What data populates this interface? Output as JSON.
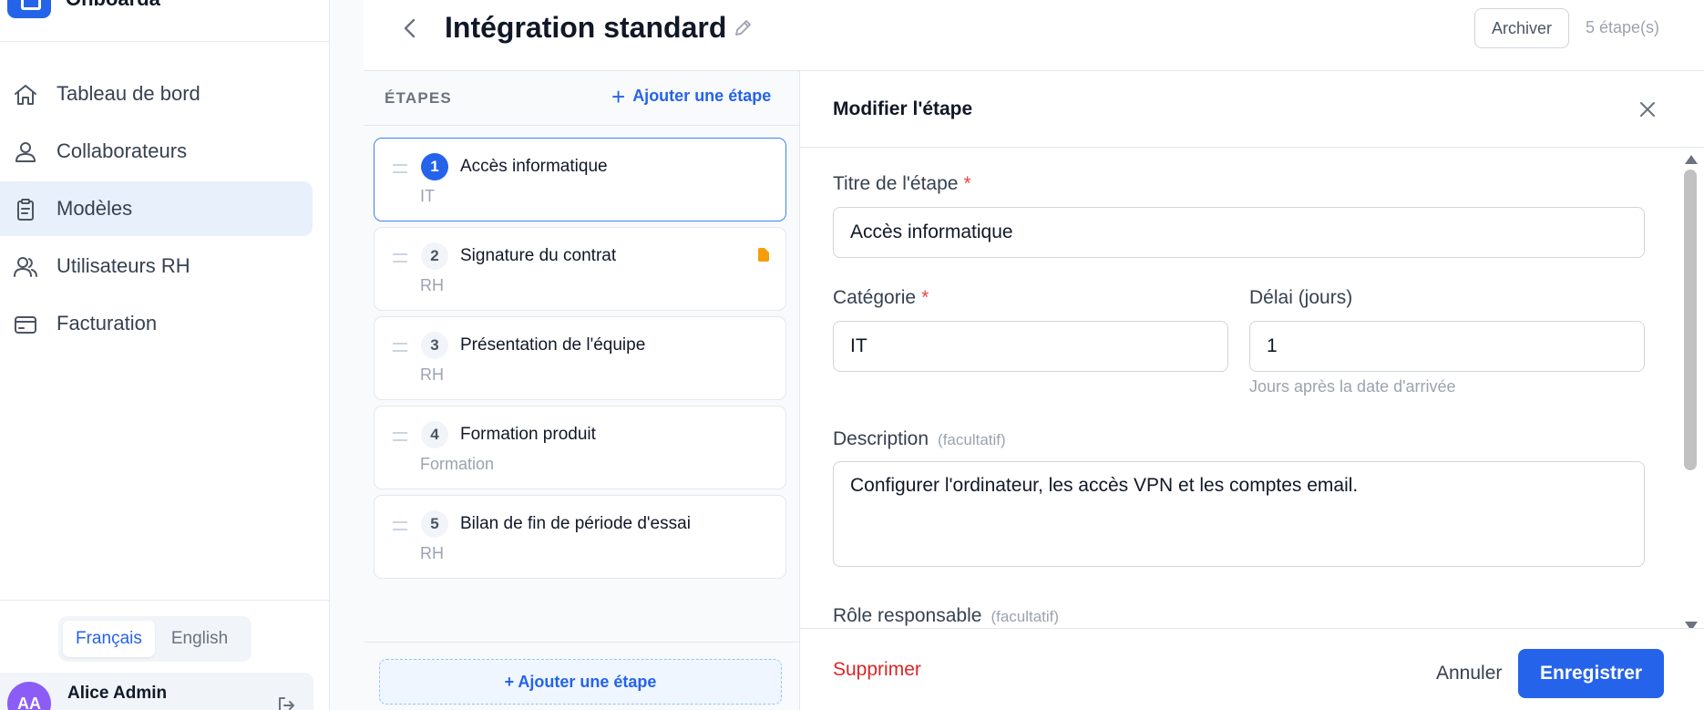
{
  "brand": {
    "name": "Onboarda"
  },
  "sidebar": {
    "items": [
      {
        "label": "Tableau de bord",
        "icon": "home-icon",
        "active": false
      },
      {
        "label": "Collaborateurs",
        "icon": "users-icon",
        "active": false
      },
      {
        "label": "Modèles",
        "icon": "clipboard-icon",
        "active": true
      },
      {
        "label": "Utilisateurs RH",
        "icon": "user-group-icon",
        "active": false
      },
      {
        "label": "Facturation",
        "icon": "credit-card-icon",
        "active": false
      }
    ],
    "languages": {
      "fr": "Français",
      "en": "English",
      "selected": "fr"
    },
    "user": {
      "initials": "AA",
      "name": "Alice Admin"
    }
  },
  "header": {
    "title": "Intégration standard",
    "archive_label": "Archiver",
    "steps_count": "5 étape(s)"
  },
  "steps_panel": {
    "title": "ÉTAPES",
    "add_link": "Ajouter une étape",
    "add_bottom": "+ Ajouter une étape",
    "steps": [
      {
        "number": "1",
        "title": "Accès informatique",
        "category": "IT",
        "has_document": false,
        "active": true
      },
      {
        "number": "2",
        "title": "Signature du contrat",
        "category": "RH",
        "has_document": true,
        "active": false
      },
      {
        "number": "3",
        "title": "Présentation de l'équipe",
        "category": "RH",
        "has_document": false,
        "active": false
      },
      {
        "number": "4",
        "title": "Formation produit",
        "category": "Formation",
        "has_document": false,
        "active": false
      },
      {
        "number": "5",
        "title": "Bilan de fin de période d'essai",
        "category": "RH",
        "has_document": false,
        "active": false
      }
    ]
  },
  "edit_panel": {
    "title": "Modifier l'étape",
    "fields": {
      "step_title": {
        "label": "Titre de l'étape",
        "required": "*",
        "value": "Accès informatique"
      },
      "category": {
        "label": "Catégorie",
        "required": "*",
        "value": "IT"
      },
      "delay": {
        "label": "Délai (jours)",
        "value": "1",
        "hint": "Jours après la date d'arrivée"
      },
      "description": {
        "label": "Description",
        "optional": "(facultatif)",
        "value": "Configurer l'ordinateur, les accès VPN et les comptes email."
      },
      "role": {
        "label": "Rôle responsable",
        "optional": "(facultatif)"
      }
    },
    "delete_label": "Supprimer",
    "cancel_label": "Annuler",
    "save_label": "Enregistrer"
  },
  "colors": {
    "accent": "#2563eb",
    "danger": "#dc2626",
    "warning": "#f59e0b",
    "avatar": "#8b5cf6"
  }
}
